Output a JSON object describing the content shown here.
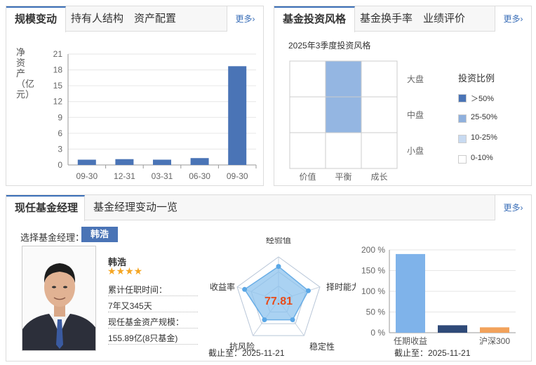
{
  "scale_panel": {
    "tabs": [
      "规模变动",
      "持有人结构",
      "资产配置"
    ],
    "more": "更多",
    "y_label": "净资产（亿元）",
    "chart_data": {
      "type": "bar",
      "categories": [
        "09-30",
        "12-31",
        "03-31",
        "06-30",
        "09-30"
      ],
      "values": [
        1.0,
        1.1,
        1.0,
        1.3,
        18.7
      ],
      "yticks": [
        0,
        3,
        6,
        9,
        12,
        15,
        18,
        21
      ],
      "ylim": [
        0,
        21
      ],
      "bar_color": "#4a74b6"
    }
  },
  "style_panel": {
    "tabs": [
      "基金投资风格",
      "基金换手率",
      "业绩评价"
    ],
    "more": "更多",
    "grid_title": "2025年3季度投资风格",
    "rows": [
      "大盘",
      "中盘",
      "小盘"
    ],
    "cols": [
      "价值",
      "平衡",
      "成长"
    ],
    "filled_cells": [
      {
        "row": 0,
        "col": 1,
        "level": 2
      },
      {
        "row": 1,
        "col": 1,
        "level": 2
      }
    ],
    "legend_title": "投资比例",
    "legend": [
      {
        "label": "＞50%",
        "color": "#4a74b6"
      },
      {
        "label": "25-50%",
        "color": "#8fb0dd"
      },
      {
        "label": "10-25%",
        "color": "#c8daf1"
      },
      {
        "label": "0-10%",
        "color": "#ffffff"
      }
    ]
  },
  "manager_panel": {
    "tabs": [
      "现任基金经理",
      "基金经理变动一览"
    ],
    "more": "更多",
    "select_label": "选择基金经理：",
    "selected_manager": "韩浩",
    "name": "韩浩",
    "stars": "★★★★",
    "tenure_label": "累计任职时间：",
    "tenure_value": "7年又345天",
    "aum_label": "现任基金资产规模：",
    "aum_value": "155.89亿(8只基金)",
    "radar": {
      "score": "77.81",
      "axes": [
        "经验值",
        "择时能力",
        "稳定性",
        "抗风险",
        "收益率"
      ],
      "values": [
        0.78,
        0.72,
        0.55,
        0.55,
        0.82
      ]
    },
    "radar_date": "截止至：2025-11-21",
    "bar_chart_data": {
      "type": "bar",
      "categories": [
        "任期收益",
        "",
        "沪深300"
      ],
      "values": [
        190,
        18,
        13
      ],
      "colors": [
        "#7fb3ea",
        "#2f4a78",
        "#f2a25b"
      ],
      "yticks": [
        "0 %",
        "50 %",
        "100 %",
        "150 %",
        "200 %"
      ],
      "ylim": [
        0,
        200
      ]
    },
    "bar_date": "截止至：2025-11-21"
  }
}
